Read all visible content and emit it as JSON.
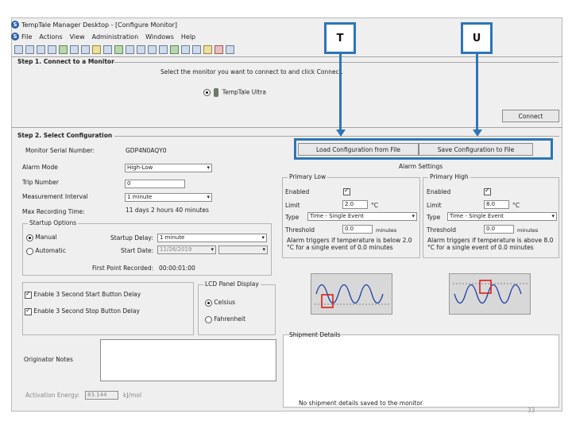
{
  "window": {
    "title": "TempTale Manager Desktop - [Configure Monitor]",
    "app_icon": "S",
    "menu": [
      "File",
      "Actions",
      "View",
      "Administration",
      "Windows",
      "Help"
    ]
  },
  "callouts": {
    "left": "T",
    "right": "U"
  },
  "step1": {
    "heading": "Step 1. Connect to a Monitor",
    "instruction": "Select the monitor you want to connect to and click Connect.",
    "device_label": "TempTale Ultra",
    "connect_label": "Connect"
  },
  "step2": {
    "heading": "Step 2. Select Configuration",
    "serial_label": "Monitor Serial Number:",
    "serial_value": "GDP4N0AQY0",
    "alarm_mode_label": "Alarm Mode",
    "alarm_mode_value": "High-Low",
    "trip_label": "Trip Number",
    "trip_value": "0",
    "interval_label": "Measurement Interval",
    "interval_value": "1 minute",
    "max_label": "Max Recording Time:",
    "max_value": "11 days 2 hours 40 minutes",
    "load_label": "Load Configuration from File",
    "save_label": "Save Configuration to File",
    "startup": {
      "title": "Startup Options",
      "manual": "Manual",
      "automatic": "Automatic",
      "delay_label": "Startup Delay:",
      "delay_value": "1 minute",
      "date_label": "Start Date:",
      "date_value": "11/26/2019",
      "first_label": "First Point Recorded:",
      "first_value": "00:00:01:00"
    },
    "enable_start": "Enable 3 Second Start Button Delay",
    "enable_stop": "Enable 3 Second Stop Button Delay",
    "lcd": {
      "title": "LCD Panel Display",
      "celsius": "Celsius",
      "fahrenheit": "Fahrenheit"
    },
    "originator_label": "Originator Notes",
    "activation_label": "Activation Energy:",
    "activation_value": "83.144",
    "activation_unit": "kJ/mol"
  },
  "alarm_settings": {
    "title": "Alarm Settings",
    "low": {
      "title": "Primary Low",
      "enabled_label": "Enabled",
      "limit_label": "Limit",
      "limit_value": "2.0",
      "unit": "°C",
      "type_label": "Type",
      "type_value": "Time - Single Event",
      "threshold_label": "Threshold",
      "threshold_value": "0.0",
      "threshold_unit": "minutes",
      "note": "Alarm triggers if temperature is below 2.0 °C for a single event of 0.0 minutes"
    },
    "high": {
      "title": "Primary High",
      "enabled_label": "Enabled",
      "limit_label": "Limit",
      "limit_value": "8.0",
      "unit": "°C",
      "type_label": "Type",
      "type_value": "Time - Single Event",
      "threshold_label": "Threshold",
      "threshold_value": "0.0",
      "threshold_unit": "minutes",
      "note": "Alarm triggers if temperature is above 8.0 °C for a single event of 0.0 minutes"
    }
  },
  "shipment": {
    "title": "Shipment Details",
    "empty_text": "No shipment details saved to the monitor"
  },
  "page_number": "33",
  "colors": {
    "callout": "#2d75b6",
    "wave": "#1f3fa8",
    "alarm": "#d82020"
  }
}
